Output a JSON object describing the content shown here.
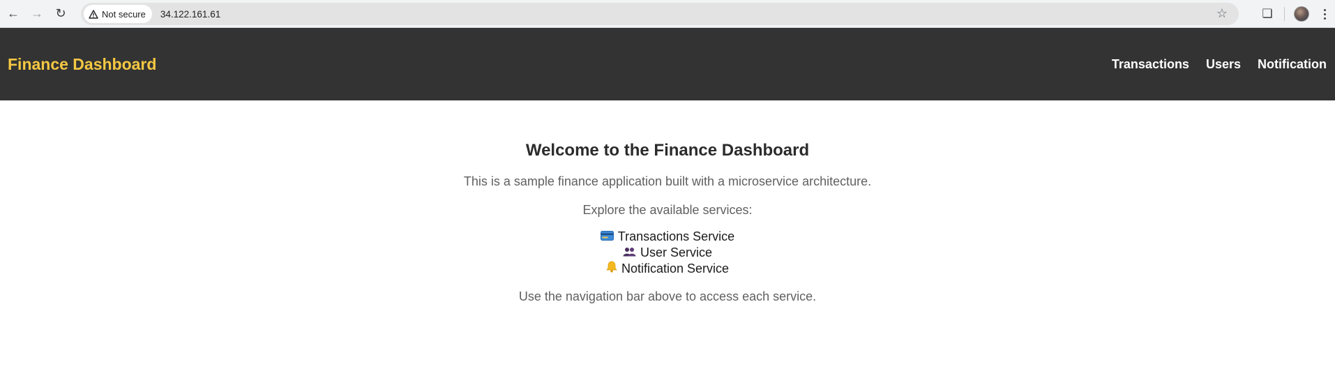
{
  "browser": {
    "security_label": "Not secure",
    "url": "34.122.161.61"
  },
  "navbar": {
    "brand": "Finance Dashboard",
    "links": [
      "Transactions",
      "Users",
      "Notification"
    ]
  },
  "main": {
    "title": "Welcome to the Finance Dashboard",
    "intro": "This is a sample finance application built with a microservice architecture.",
    "explore": "Explore the available services:",
    "services": [
      {
        "icon": "credit-card-icon",
        "label": "Transactions Service"
      },
      {
        "icon": "users-icon",
        "label": "User Service"
      },
      {
        "icon": "bell-icon",
        "label": "Notification Service"
      }
    ],
    "hint": "Use the navigation bar above to access each service."
  },
  "colors": {
    "navbar_bg": "#333333",
    "brand": "#f5c842",
    "nav_link": "#ffffff",
    "body_text": "#606060"
  }
}
